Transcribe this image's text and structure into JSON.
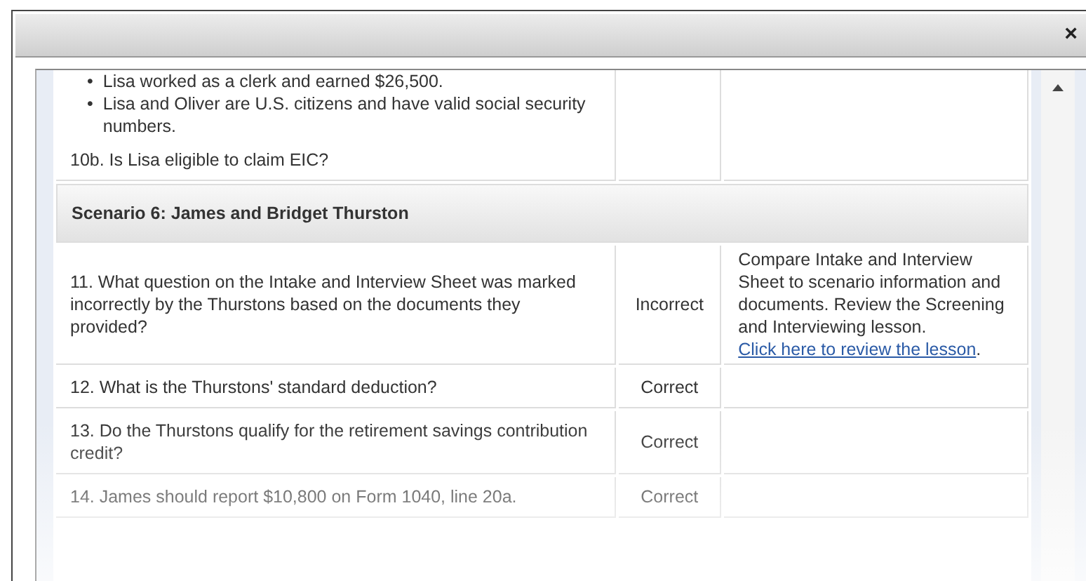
{
  "dialog": {
    "close_label": "×"
  },
  "rows": [
    {
      "kind": "question",
      "bullet_mark": "•",
      "bullets": [
        "Lisa worked as a clerk and earned $26,500.",
        "Lisa and Oliver are U.S. citizens and have valid social security numbers."
      ],
      "question": "10b. Is Lisa eligible to claim EIC?"
    },
    {
      "kind": "scenario",
      "title": "Scenario 6: James and Bridget Thurston"
    },
    {
      "kind": "question",
      "question": "11. What question on the Intake and Interview Sheet was marked incorrectly by the Thurstons based on the documents they provided?",
      "result": "Incorrect",
      "feedback": "Compare Intake and Interview Sheet to scenario information and documents. Review the Screening and Interviewing lesson.",
      "link": "Click here to review the lesson",
      "link_suffix": "."
    },
    {
      "kind": "question",
      "question": "12. What is the Thurstons' standard deduction?",
      "result": "Correct"
    },
    {
      "kind": "question",
      "question": "13. Do the Thurstons qualify for the retirement savings contribution credit?",
      "result": "Correct"
    },
    {
      "kind": "question",
      "question": "14. James should report $10,800 on Form 1040, line 20a.",
      "result": "Correct"
    }
  ]
}
